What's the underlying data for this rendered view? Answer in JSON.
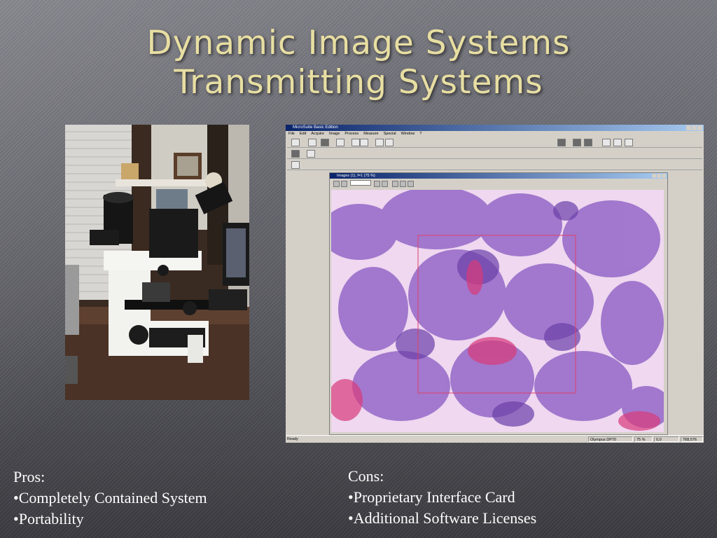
{
  "slide": {
    "title_line1": "Dynamic Image Systems",
    "title_line2": "Transmitting Systems"
  },
  "pros": {
    "heading": "Pros:",
    "items": [
      "•Completely Contained System",
      "•Portability"
    ]
  },
  "cons": {
    "heading": "Cons:",
    "items": [
      "•Proprietary Interface Card",
      "•Additional Software Licenses"
    ]
  },
  "software_screenshot": {
    "window_title": "MicroSuite Basic Edition",
    "menu": [
      "File",
      "Edit",
      "Acquire",
      "Image",
      "Process",
      "Measure",
      "Special",
      "Window",
      "?"
    ],
    "image_window_title": "Images (1), f=1 (75 %)",
    "status": {
      "left": "Ready",
      "camera": "Olympus DP70",
      "zoom": "75 %",
      "coords": "0,0",
      "size": "768,576"
    }
  },
  "colors": {
    "title": "#e7dea2",
    "body_text": "#ffffff",
    "stain_purple": "#8a55c0",
    "stain_pink": "#e9c4ec"
  }
}
